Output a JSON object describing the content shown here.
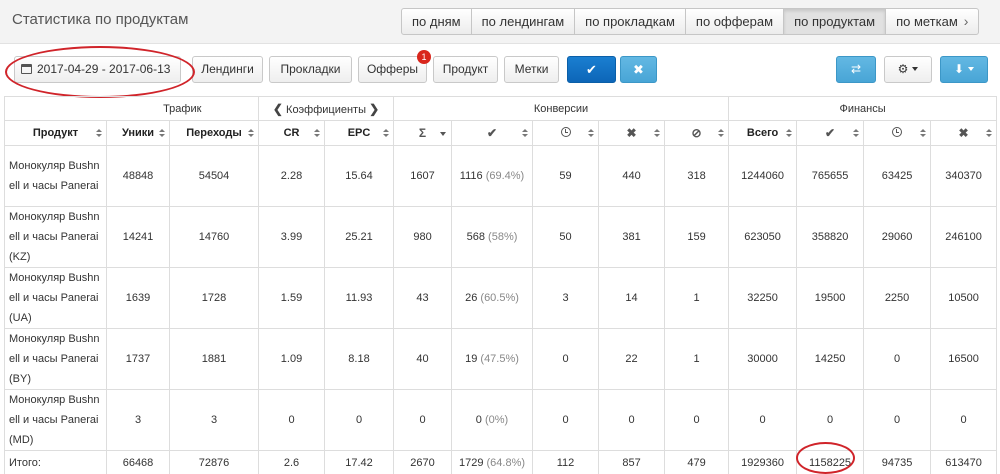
{
  "header": {
    "title": "Статистика по продуктам",
    "tabs": [
      {
        "label": "по дням",
        "active": false
      },
      {
        "label": "по лендингам",
        "active": false
      },
      {
        "label": "по прокладкам",
        "active": false
      },
      {
        "label": "по офферам",
        "active": false
      },
      {
        "label": "по продуктам",
        "active": true
      },
      {
        "label": "по меткам",
        "active": false
      }
    ]
  },
  "filters": {
    "date_range": "2017-04-29 - 2017-06-13",
    "landings": "Лендинги",
    "prelandings": "Прокладки",
    "offers": "Офферы",
    "offers_badge": "1",
    "product": "Продукт",
    "tags": "Метки",
    "apply_icon": "check-icon",
    "reset_icon": "times-icon",
    "shuffle_icon": "shuffle-icon",
    "settings_icon": "gear-icon",
    "export_icon": "download-icon"
  },
  "table": {
    "groups": {
      "traffic": "Трафик",
      "coefficients": "Коэффициенты",
      "conversions": "Конверсии",
      "finance": "Финансы"
    },
    "columns": {
      "product": "Продукт",
      "uniques": "Уники",
      "clicks": "Переходы",
      "cr": "CR",
      "epc": "EPC",
      "sum": "Σ",
      "approved": "✔",
      "hold": "clock-icon",
      "rejected": "✖",
      "trash": "⊘",
      "total": "Всего",
      "fin_approved": "✔",
      "fin_hold": "clock-icon",
      "fin_rejected": "✖"
    },
    "rows": [
      {
        "product": "Монокуляр Bushnell и часы Panerai",
        "uniques": "48848",
        "clicks": "54504",
        "cr": "2.28",
        "epc": "15.64",
        "sum": "1607",
        "approved": "1116",
        "approved_pct": "(69.4%)",
        "hold": "59",
        "rejected": "440",
        "trash": "318",
        "total": "1244060",
        "fin_approved": "765655",
        "fin_hold": "63425",
        "fin_rejected": "340370"
      },
      {
        "product": "Монокуляр Bushnell и часы Panerai (KZ)",
        "uniques": "14241",
        "clicks": "14760",
        "cr": "3.99",
        "epc": "25.21",
        "sum": "980",
        "approved": "568",
        "approved_pct": "(58%)",
        "hold": "50",
        "rejected": "381",
        "trash": "159",
        "total": "623050",
        "fin_approved": "358820",
        "fin_hold": "29060",
        "fin_rejected": "246100"
      },
      {
        "product": "Монокуляр Bushnell и часы Panerai (UA)",
        "uniques": "1639",
        "clicks": "1728",
        "cr": "1.59",
        "epc": "11.93",
        "sum": "43",
        "approved": "26",
        "approved_pct": "(60.5%)",
        "hold": "3",
        "rejected": "14",
        "trash": "1",
        "total": "32250",
        "fin_approved": "19500",
        "fin_hold": "2250",
        "fin_rejected": "10500"
      },
      {
        "product": "Монокуляр Bushnell и часы Panerai (BY)",
        "uniques": "1737",
        "clicks": "1881",
        "cr": "1.09",
        "epc": "8.18",
        "sum": "40",
        "approved": "19",
        "approved_pct": "(47.5%)",
        "hold": "0",
        "rejected": "22",
        "trash": "1",
        "total": "30000",
        "fin_approved": "14250",
        "fin_hold": "0",
        "fin_rejected": "16500"
      },
      {
        "product": "Монокуляр Bushnell и часы Panerai (MD)",
        "uniques": "3",
        "clicks": "3",
        "cr": "0",
        "epc": "0",
        "sum": "0",
        "approved": "0",
        "approved_pct": "(0%)",
        "hold": "0",
        "rejected": "0",
        "trash": "0",
        "total": "0",
        "fin_approved": "0",
        "fin_hold": "0",
        "fin_rejected": "0"
      }
    ],
    "totals": {
      "label": "Итого:",
      "uniques": "66468",
      "clicks": "72876",
      "cr": "2.6",
      "epc": "17.42",
      "sum": "2670",
      "approved": "1729",
      "approved_pct": "(64.8%)",
      "hold": "112",
      "rejected": "857",
      "trash": "479",
      "total": "1929360",
      "fin_approved": "1158225",
      "fin_hold": "94735",
      "fin_rejected": "613470"
    }
  },
  "annotations": {
    "highlight_color": "#d0242a"
  }
}
